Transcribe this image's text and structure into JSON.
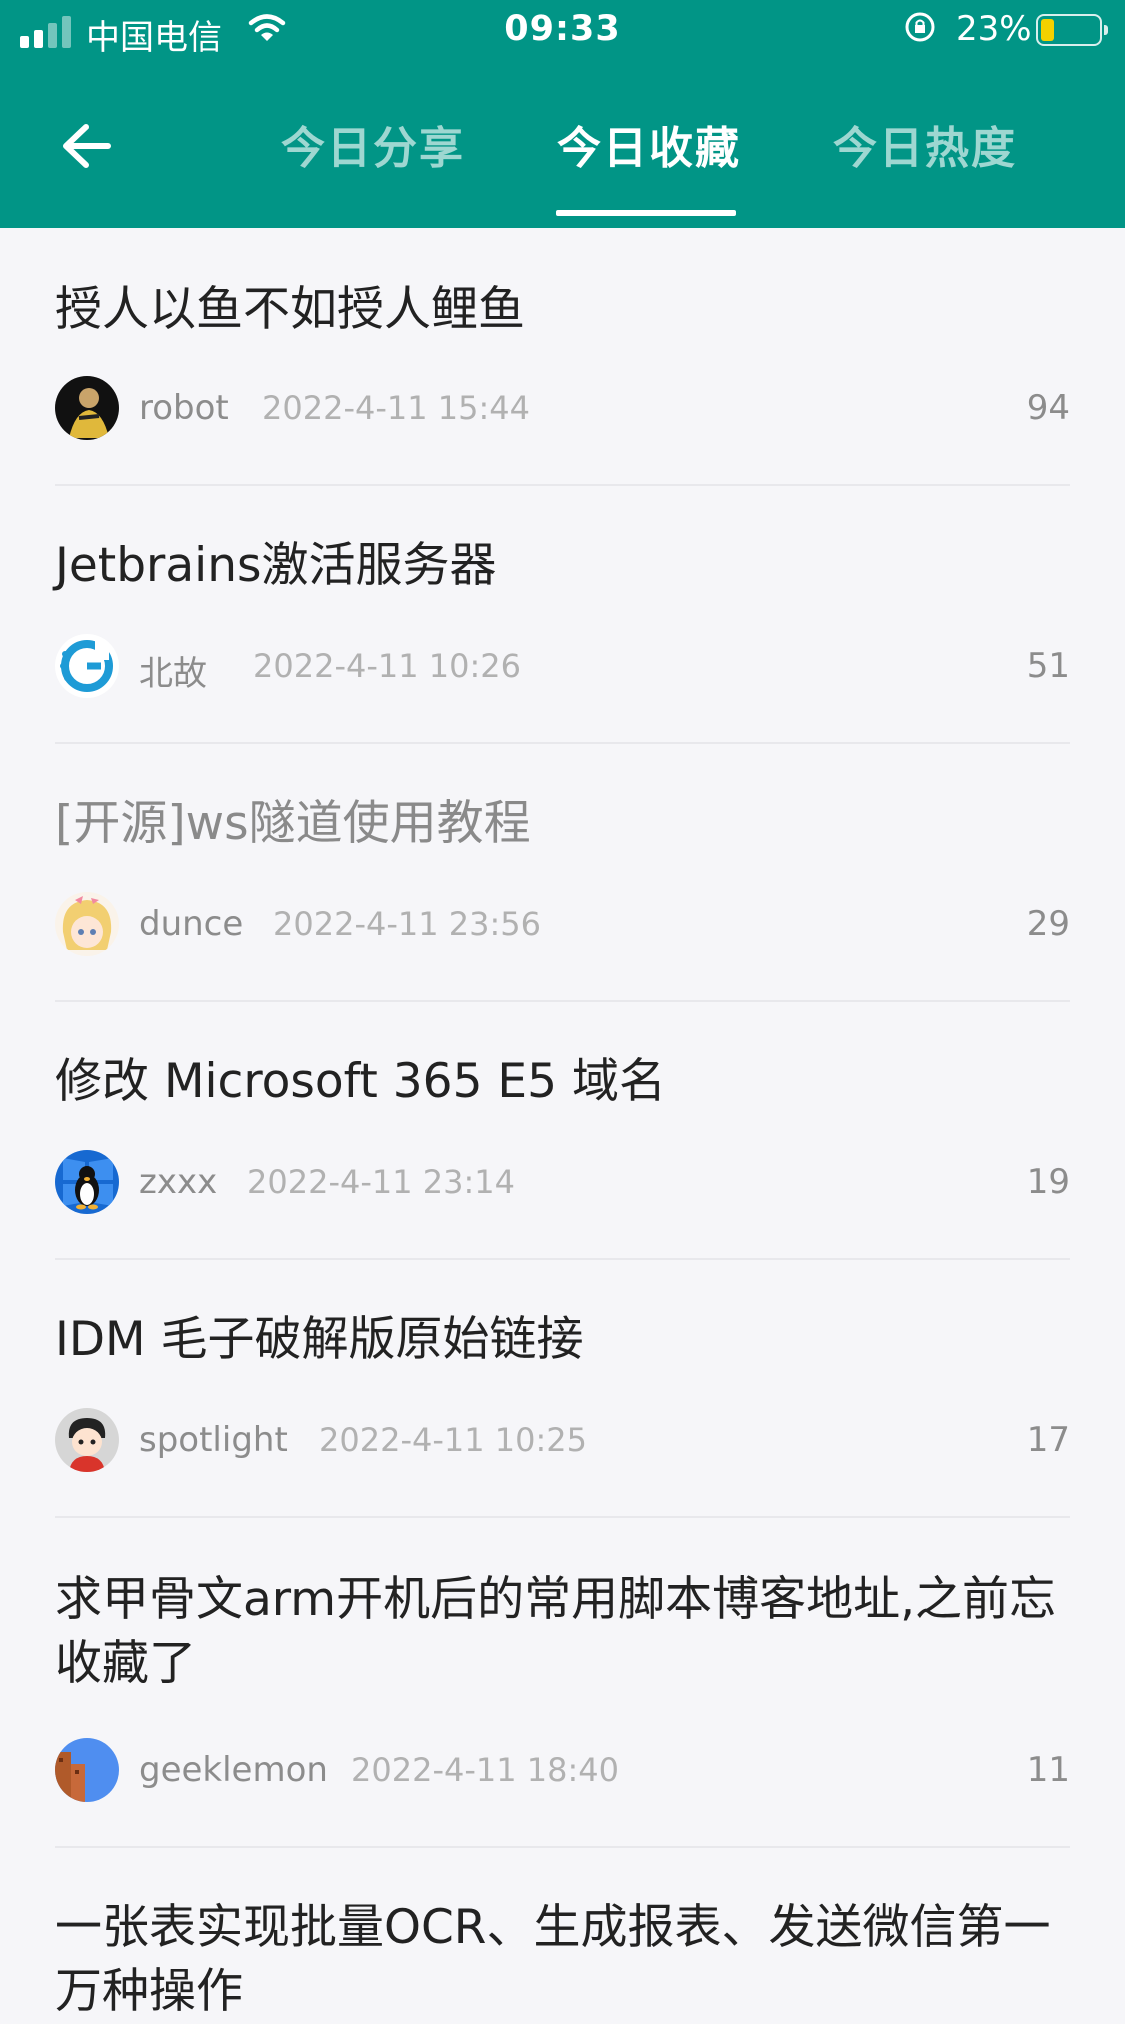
{
  "status_bar": {
    "carrier": "中国电信",
    "time": "09:33",
    "battery": "23%",
    "battery_level": 0.23
  },
  "nav": {
    "back_icon": "arrow-left-icon",
    "tabs": [
      {
        "label": "今日分享",
        "active": false
      },
      {
        "label": "今日收藏",
        "active": true
      },
      {
        "label": "今日热度",
        "active": false
      }
    ]
  },
  "posts": [
    {
      "title": "授人以鱼不如授人鲤鱼",
      "author": "robot",
      "time": "2022-4-11 15:44",
      "count": "94",
      "avatar_color": "#111111"
    },
    {
      "title": "Jetbrains激活服务器",
      "author": "北故",
      "time": "2022-4-11 10:26",
      "count": "51",
      "avatar_color": "#1e9bd6"
    },
    {
      "title": "[开源]ws隧道使用教程",
      "author": "dunce",
      "time": "2022-4-11 23:56",
      "count": "29",
      "avatar_color": "#f1d27a",
      "dimmed": true
    },
    {
      "title": "修改 Microsoft 365 E5 域名",
      "author": "zxxx",
      "time": "2022-4-11 23:14",
      "count": "19",
      "avatar_color": "#1769d1"
    },
    {
      "title": "IDM 毛子破解版原始链接",
      "author": "spotlight",
      "time": "2022-4-11 10:25",
      "count": "17",
      "avatar_color": "#d9d9d9"
    },
    {
      "title": "求甲骨文arm开机后的常用脚本博客地址,之前忘收藏了",
      "author": "geeklemon",
      "time": "2022-4-11 18:40",
      "count": "11",
      "avatar_color": "#4f8ef0"
    },
    {
      "title": "一张表实现批量OCR、生成报表、发送微信第一万种操作"
    }
  ]
}
